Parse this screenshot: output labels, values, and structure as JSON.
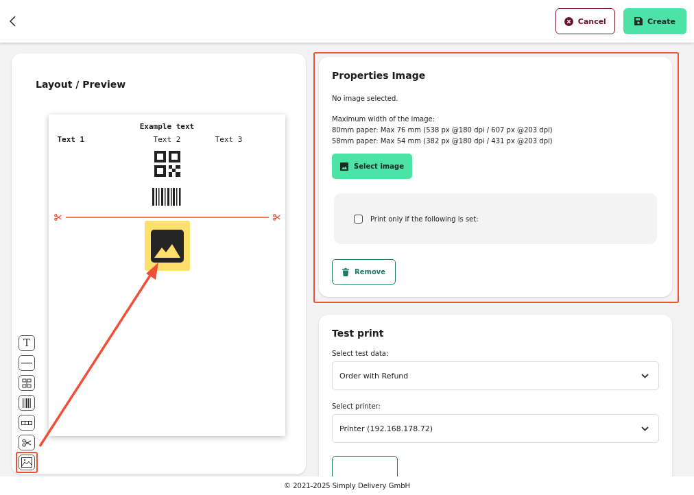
{
  "header": {
    "buttons": [
      {
        "kind": "cancel",
        "label": "Cancel"
      },
      {
        "kind": "create",
        "label": "Create"
      }
    ]
  },
  "preview": {
    "title": "Layout / Preview",
    "receipt": {
      "heading": "Example text",
      "columns": [
        {
          "text": "Text 1",
          "bold": true
        },
        {
          "text": "Text 2",
          "bold": false
        },
        {
          "text": "Text 3",
          "bold": false
        }
      ]
    },
    "tools": [
      {
        "kind": "text",
        "glyph": "T",
        "highlighted": false
      },
      {
        "kind": "line",
        "highlighted": false
      },
      {
        "kind": "qr",
        "highlighted": false
      },
      {
        "kind": "barcode",
        "highlighted": false
      },
      {
        "kind": "columns",
        "highlighted": false
      },
      {
        "kind": "cut",
        "highlighted": false
      },
      {
        "kind": "image",
        "highlighted": true
      }
    ]
  },
  "properties": {
    "title": "Properties Image",
    "status": "No image selected.",
    "info": [
      "Maximum width of the image:",
      "80mm paper: Max 76 mm (538 px @180 dpi / 607 px @203 dpi)",
      "58mm paper: Max 54 mm (382 px @180 dpi / 431 px @203 dpi)"
    ],
    "select_button": "Select image",
    "condition": {
      "label": "Print only if the following is set:",
      "checked": false
    },
    "remove_button": "Remove"
  },
  "test_print": {
    "title": "Test print",
    "fields": [
      {
        "label": "Select test data:",
        "value": "Order with Refund"
      },
      {
        "label": "Select printer:",
        "value": "Printer (192.168.178.72)"
      }
    ]
  },
  "footer": "© 2021-2025 Simply Delivery GmbH"
}
